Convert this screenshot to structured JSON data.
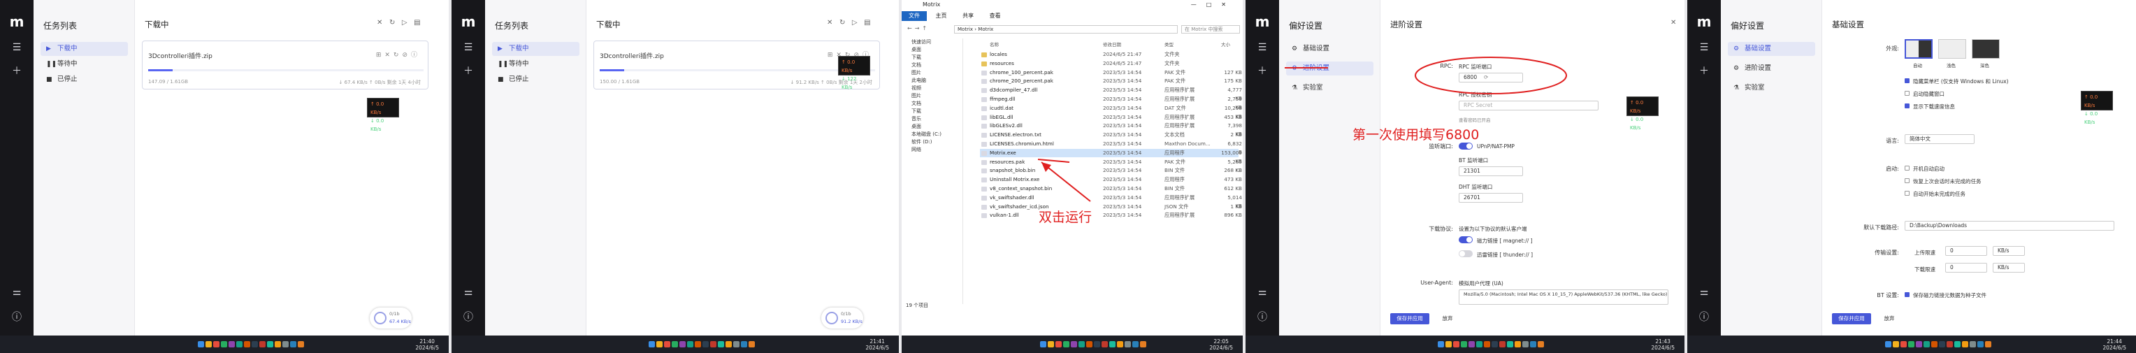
{
  "colors": {
    "accent": "#4657d8",
    "annotation": "#e02020",
    "rail": "#17171b"
  },
  "panel1": {
    "sidebar_title": "任务列表",
    "items": [
      "下载中",
      "等待中",
      "已停止"
    ],
    "main_title": "下载中",
    "task": {
      "name": "3Dcontrolleri插件.zip",
      "progress": 0.09,
      "meta": "147.09 / 1.61GB",
      "meta2": "↓ 67.4 KB/s ↑ 0B/s 剩余 1天 4小时"
    },
    "speed_up": "↑ 0.0 KB/s",
    "speed_down": "↓ 0.0 KB/s",
    "fab": {
      "t1": "0/1b",
      "t2": "67.4 KB/s"
    },
    "clock": {
      "time": "21:40",
      "date": "2024/6/5"
    }
  },
  "panel2": {
    "sidebar_title": "任务列表",
    "items": [
      "下载中",
      "等待中",
      "已停止"
    ],
    "main_title": "下载中",
    "task": {
      "name": "3Dcontrolleri插件.zip",
      "progress": 0.09,
      "meta": "150.00 / 1.61GB",
      "meta2": "↓ 91.2 KB/s ↑ 0B/s 剩余 1天 2小时"
    },
    "speed_up": "↑ 0.0 KB/s",
    "speed_down": "↓ 122 KB/s",
    "fab": {
      "t1": "0/1b",
      "t2": "91.2 KB/s"
    },
    "clock": {
      "time": "21:41",
      "date": "2024/6/5"
    }
  },
  "explorer": {
    "title": "Motrix",
    "menu": [
      "文件",
      "主页",
      "共享",
      "查看"
    ],
    "address": "Motrix › Motrix",
    "search": "在 Motrix 中搜索",
    "nav": [
      "快速访问",
      "桌面",
      "下载",
      "文档",
      "图片",
      "此电脑",
      "视频",
      "图片",
      "文档",
      "下载",
      "音乐",
      "桌面",
      "本地磁盘 (C:)",
      "软件 (D:)",
      "网络"
    ],
    "headers": [
      "名称",
      "修改日期",
      "类型",
      "大小"
    ],
    "files": [
      {
        "n": "locales",
        "d": "2024/6/5 21:47",
        "t": "文件夹",
        "s": "",
        "folder": true
      },
      {
        "n": "resources",
        "d": "2024/6/5 21:47",
        "t": "文件夹",
        "s": "",
        "folder": true
      },
      {
        "n": "chrome_100_percent.pak",
        "d": "2023/5/3 14:54",
        "t": "PAK 文件",
        "s": "127 KB"
      },
      {
        "n": "chrome_200_percent.pak",
        "d": "2023/5/3 14:54",
        "t": "PAK 文件",
        "s": "175 KB"
      },
      {
        "n": "d3dcompiler_47.dll",
        "d": "2023/5/3 14:54",
        "t": "应用程序扩展",
        "s": "4,777 KB"
      },
      {
        "n": "ffmpeg.dll",
        "d": "2023/5/3 14:54",
        "t": "应用程序扩展",
        "s": "2,759 KB"
      },
      {
        "n": "icudtl.dat",
        "d": "2023/5/3 14:54",
        "t": "DAT 文件",
        "s": "10,298 KB"
      },
      {
        "n": "libEGL.dll",
        "d": "2023/5/3 14:54",
        "t": "应用程序扩展",
        "s": "453 KB"
      },
      {
        "n": "libGLESv2.dll",
        "d": "2023/5/3 14:54",
        "t": "应用程序扩展",
        "s": "7,398 KB"
      },
      {
        "n": "LICENSE.electron.txt",
        "d": "2023/5/3 14:54",
        "t": "文本文档",
        "s": "2 KB"
      },
      {
        "n": "LICENSES.chromium.html",
        "d": "2023/5/3 14:54",
        "t": "Maxthon Docum...",
        "s": "6,832 KB"
      },
      {
        "n": "Motrix.exe",
        "d": "2023/5/3 14:54",
        "t": "应用程序",
        "s": "153,009 KB",
        "sel": true
      },
      {
        "n": "resources.pak",
        "d": "2023/5/3 14:54",
        "t": "PAK 文件",
        "s": "5,285 KB"
      },
      {
        "n": "snapshot_blob.bin",
        "d": "2023/5/3 14:54",
        "t": "BIN 文件",
        "s": "268 KB"
      },
      {
        "n": "Uninstall Motrix.exe",
        "d": "2023/5/3 14:54",
        "t": "应用程序",
        "s": "473 KB"
      },
      {
        "n": "v8_context_snapshot.bin",
        "d": "2023/5/3 14:54",
        "t": "BIN 文件",
        "s": "612 KB"
      },
      {
        "n": "vk_swiftshader.dll",
        "d": "2023/5/3 14:54",
        "t": "应用程序扩展",
        "s": "5,014 KB"
      },
      {
        "n": "vk_swiftshader_icd.json",
        "d": "2023/5/3 14:54",
        "t": "JSON 文件",
        "s": "1 KB"
      },
      {
        "n": "vulkan-1.dll",
        "d": "2023/5/3 14:54",
        "t": "应用程序扩展",
        "s": "896 KB"
      }
    ],
    "status": "19 个项目",
    "annotation": "双击运行",
    "clock": {
      "time": "22:05",
      "date": "2024/6/5"
    }
  },
  "panel4": {
    "sidebar_title": "偏好设置",
    "items": [
      "基础设置",
      "进阶设置",
      "实验室"
    ],
    "main_title": "进阶设置",
    "rpc_label": "RPC:",
    "rpc_port_label": "RPC 监听端口",
    "rpc_port": "6800",
    "rpc_secret_label": "RPC 授权密钥",
    "rpc_secret_ph": "RPC Secret",
    "rpc_note": "查看密码已开启",
    "annotation": "第一次使用填写6800",
    "port_label": "监听端口:",
    "upnp": "UPnP/NAT-PMP",
    "bt_port_label": "BT 监听端口",
    "bt_port": "21301",
    "dht_port_label": "DHT 监听端口",
    "dht_port": "26701",
    "protocol_label": "下载协议:",
    "protocol_desc": "设置为以下协议的默认客户端",
    "magnet": "磁力链接 [ magnet:// ]",
    "thunder": "迅雷链接 [ thunder:// ]",
    "ua_label": "User-Agent:",
    "ua_desc": "模拟用户代理 (UA)",
    "ua_value": "Mozilla/5.0 (Macintosh; Intel Mac OS X 10_15_7) AppleWebKit/537.36 (KHTML, like Gecko)",
    "save": "保存并应用",
    "discard": "放弃",
    "speed_up": "↑ 0.0 KB/s",
    "speed_down": "↓ 0.0 KB/s",
    "clock": {
      "time": "21:43",
      "date": "2024/6/5"
    }
  },
  "panel5": {
    "sidebar_title": "偏好设置",
    "items": [
      "基础设置",
      "进阶设置",
      "实验室"
    ],
    "main_title": "基础设置",
    "appearance_label": "外观:",
    "themes": [
      "自动",
      "浅色",
      "深色"
    ],
    "tray_opt": "隐藏菜单栏 (仅支持 Windows 和 Linux)",
    "opt2": "启动隐藏窗口",
    "opt3": "显示下载速度信息",
    "lang_label": "语言:",
    "lang": "简体中文",
    "startup_label": "启动:",
    "startup_opts": [
      "开机自动启动",
      "恢复上次会话时未完成的任务",
      "自动开始未完成的任务"
    ],
    "dir_label": "默认下载路径:",
    "dir": "D:\\Backup\\Downloads",
    "limit_label": "传输设置:",
    "up_label": "上传限速",
    "down_label": "下载限速",
    "up_val": "0",
    "down_val": "0",
    "unit": "KB/s",
    "bt_label": "BT 设置:",
    "bt_opt": "保存磁力链接元数据为种子文件",
    "save": "保存并应用",
    "discard": "放弃",
    "speed_up": "↑ 0.0 KB/s",
    "speed_down": "↓ 0.0 KB/s",
    "clock": {
      "time": "21:44",
      "date": "2024/6/5"
    }
  }
}
